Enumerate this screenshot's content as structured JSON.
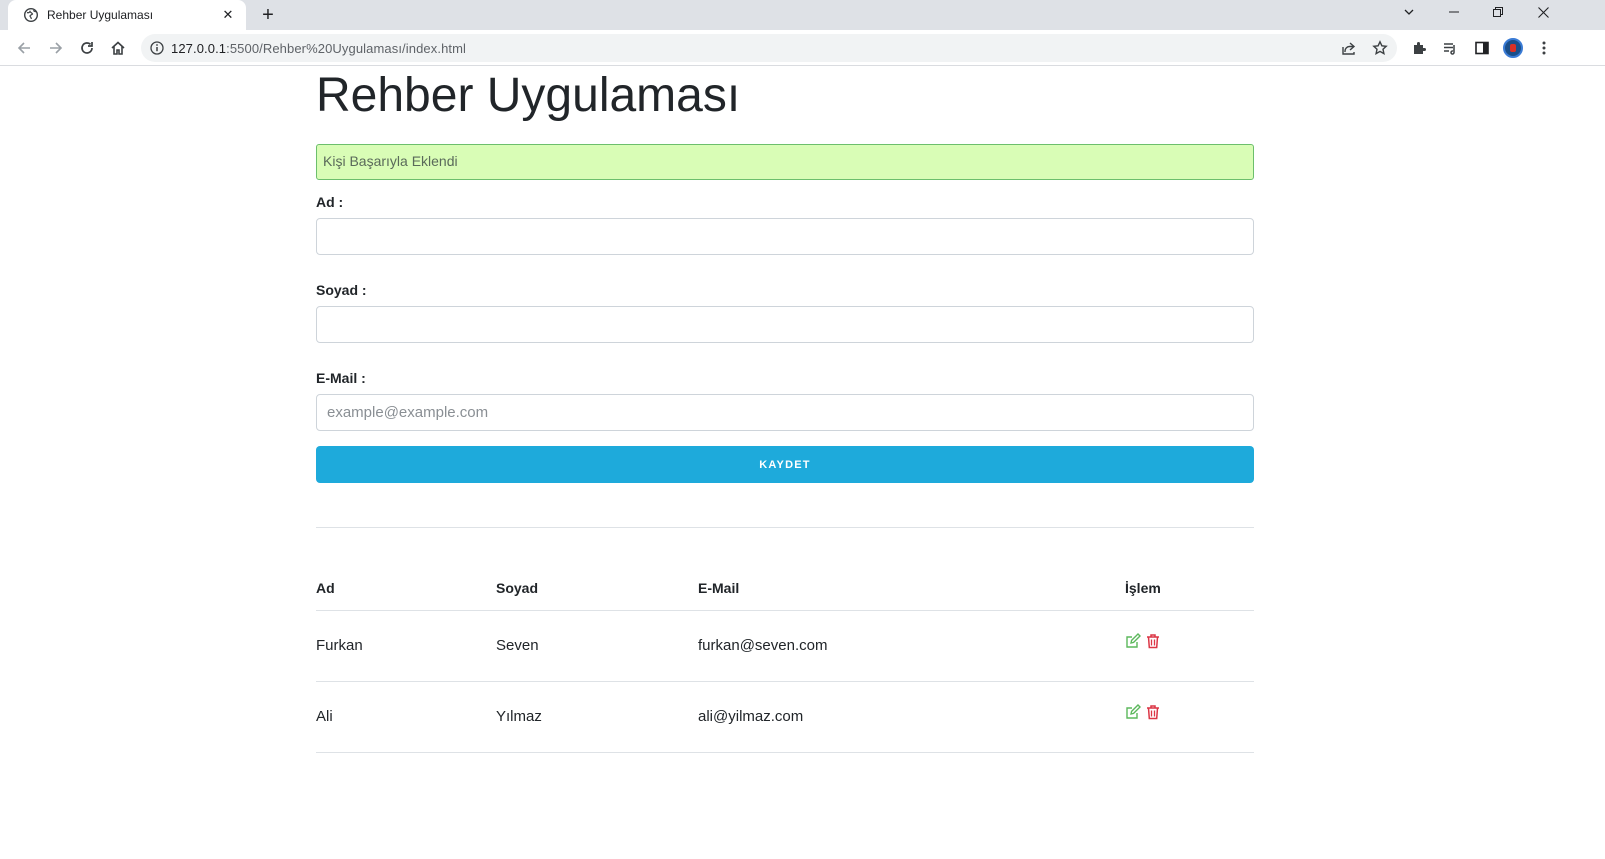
{
  "browser": {
    "tab_title": "Rehber Uygulaması",
    "url_host": "127.0.0.1",
    "url_rest": ":5500/Rehber%20Uygulaması/index.html"
  },
  "page": {
    "title": "Rehber Uygulaması",
    "alert_text": "Kişi Başarıyla Eklendi",
    "alert_color": "#d9fdb6",
    "form": {
      "first_name_label": "Ad :",
      "first_name_value": "",
      "last_name_label": "Soyad :",
      "last_name_value": "",
      "email_label": "E-Mail :",
      "email_placeholder": "example@example.com",
      "email_value": "",
      "save_label": "KAYDET",
      "save_color": "#1eaadb"
    },
    "table": {
      "headers": [
        "Ad",
        "Soyad",
        "E-Mail",
        "İşlem"
      ],
      "rows": [
        {
          "ad": "Furkan",
          "soyad": "Seven",
          "email": "furkan@seven.com"
        },
        {
          "ad": "Ali",
          "soyad": "Yılmaz",
          "email": "ali@yilmaz.com"
        }
      ],
      "action_icons": [
        "edit-icon",
        "trash-icon"
      ]
    }
  }
}
